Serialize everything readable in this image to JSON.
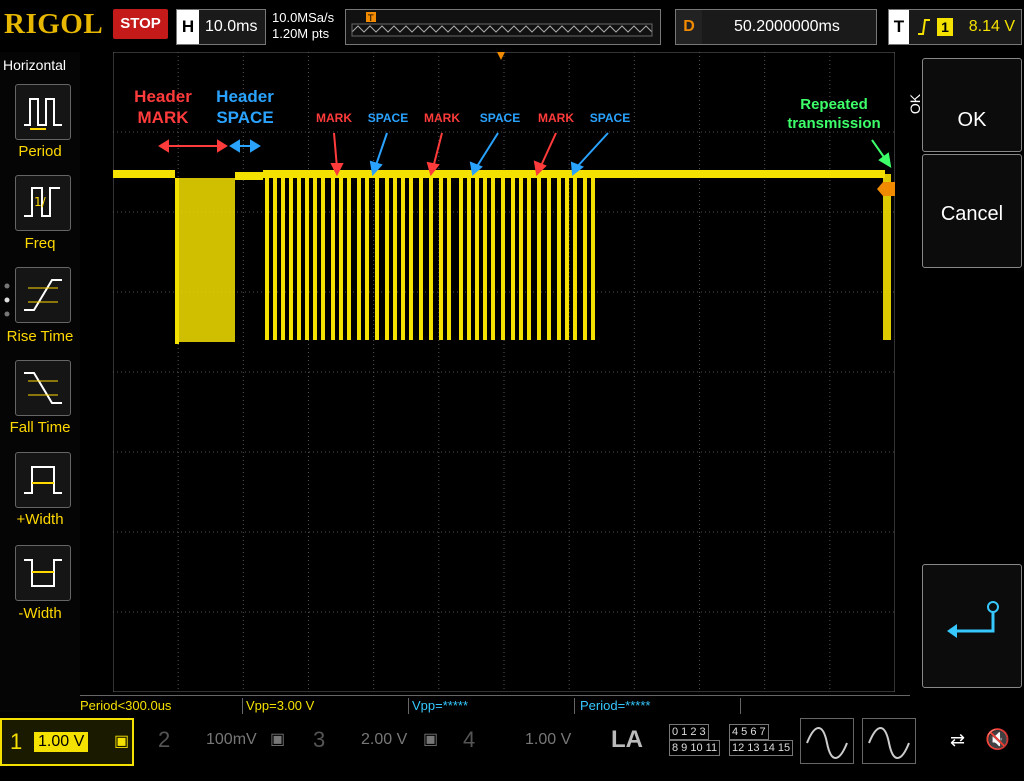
{
  "topbar": {
    "brand": "RIGOL",
    "run_state": "STOP",
    "h_label": "H",
    "h_value": "10.0ms",
    "sample_rate": "10.0MSa/s",
    "points": "1.20M pts",
    "d_label": "D",
    "d_value": "50.2000000ms",
    "t_label": "T",
    "trigger_channel": "1",
    "trigger_level": "8.14 V"
  },
  "left_menu": {
    "title": "Horizontal",
    "items": [
      {
        "label": "Period",
        "icon": "period-icon"
      },
      {
        "label": "Freq",
        "icon": "frequency-icon"
      },
      {
        "label": "Rise Time",
        "icon": "rise-time-icon"
      },
      {
        "label": "Fall Time",
        "icon": "fall-time-icon"
      },
      {
        "label": "+Width",
        "icon": "positive-width-icon"
      },
      {
        "label": "-Width",
        "icon": "negative-width-icon"
      }
    ]
  },
  "right_menu": {
    "side_label": "OK",
    "ok_label": "OK",
    "cancel_label": "Cancel",
    "enter_icon": "enter-icon"
  },
  "annotations": {
    "header_mark": "Header\nMARK",
    "header_space": "Header\nSPACE",
    "mark": "MARK",
    "space": "SPACE",
    "repeated": "Repeated\ntransmission",
    "colors": {
      "mark": "#ff3b3b",
      "space": "#2aa3ff",
      "repeated": "#3dff6a"
    }
  },
  "measurements": [
    {
      "label": "Period<300.0us",
      "color": "#f5e100"
    },
    {
      "label": "Vpp=3.00 V",
      "color": "#f5e100"
    },
    {
      "label": "Vpp=*****",
      "color": "#36c8ff"
    },
    {
      "label": "Period=*****",
      "color": "#36c8ff"
    }
  ],
  "channels": [
    {
      "num": "1",
      "scale": "1.00 V",
      "color": "#f5e100",
      "active": true
    },
    {
      "num": "2",
      "scale": "100mV",
      "color": "#36c8ff",
      "active": false
    },
    {
      "num": "3",
      "scale": "2.00 V",
      "color": "#d040d0",
      "active": false
    },
    {
      "num": "4",
      "scale": "1.00 V",
      "color": "#3a6aff",
      "active": false
    }
  ],
  "la_label": "LA",
  "la_groups": [
    "0 1 2 3",
    "8 9 10 11",
    "4 5 6 7",
    "12 13 14 15"
  ],
  "colors": {
    "trace": "#f5e100",
    "trigger": "#f08a00",
    "grid": "#555555"
  }
}
